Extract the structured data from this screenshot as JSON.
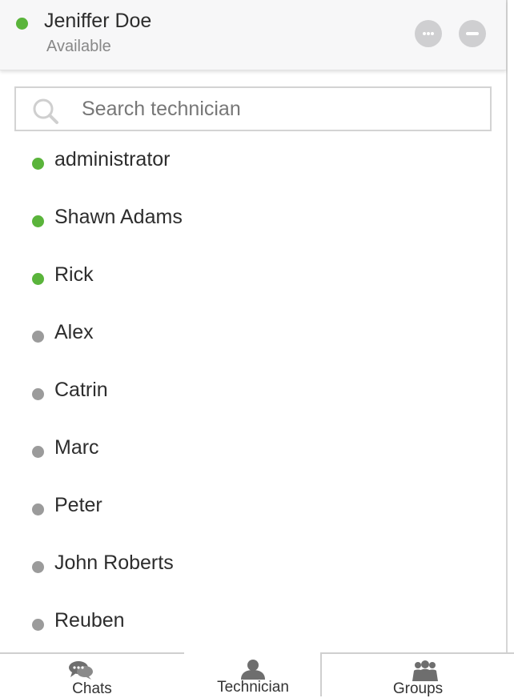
{
  "header": {
    "user_name": "Jeniffer Doe",
    "status": "Available",
    "status_color": "#5ab43b",
    "more_icon": "more-icon",
    "minimize_icon": "minimize-icon"
  },
  "search": {
    "placeholder": "Search technician",
    "value": "",
    "icon": "search-icon"
  },
  "technicians": [
    {
      "name": "administrator",
      "online": true
    },
    {
      "name": "Shawn Adams",
      "online": true
    },
    {
      "name": "Rick",
      "online": true
    },
    {
      "name": "Alex",
      "online": false
    },
    {
      "name": "Catrin",
      "online": false
    },
    {
      "name": "Marc",
      "online": false
    },
    {
      "name": "Peter",
      "online": false
    },
    {
      "name": "John Roberts",
      "online": false
    },
    {
      "name": "Reuben",
      "online": false
    }
  ],
  "colors": {
    "online": "#5ab43b",
    "offline": "#9b9b9b"
  },
  "tabs": [
    {
      "label": "Chats",
      "icon": "chat-bubbles-icon",
      "active": false
    },
    {
      "label": "Technician",
      "icon": "person-icon",
      "active": true
    },
    {
      "label": "Groups",
      "icon": "group-icon",
      "active": false
    }
  ]
}
